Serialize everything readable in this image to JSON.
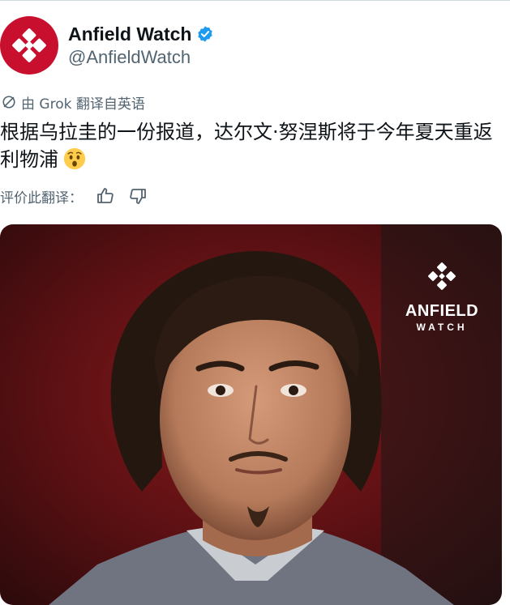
{
  "tweet": {
    "author": {
      "display_name": "Anfield Watch",
      "handle": "@AnfieldWatch",
      "verified": true,
      "avatar_color": "#c8102e"
    },
    "translation_note": "由 Grok 翻译自英语",
    "text": "根据乌拉圭的一份报道，达尔文·努涅斯将于今年夏天重返利物浦",
    "emoji": "hushed-face-emoji",
    "rate_label": "评价此翻译："
  },
  "media": {
    "watermark": {
      "title": "ANFIELD",
      "subtitle": "WATCH"
    }
  },
  "colors": {
    "text": "#0f1419",
    "secondary": "#536471",
    "verified": "#1d9bf0",
    "brand_red": "#c8102e"
  }
}
